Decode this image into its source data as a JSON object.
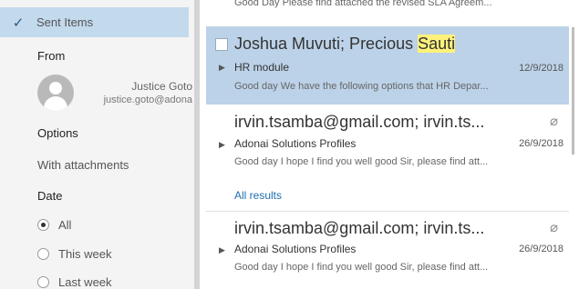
{
  "filters": {
    "folder_selected": "Sent Items",
    "from_heading": "From",
    "person": {
      "name": "Justice Goto",
      "email": "justice.goto@adona"
    },
    "options_heading": "Options",
    "with_attachments": "With attachments",
    "date_heading": "Date",
    "date_options": [
      "All",
      "This week",
      "Last week"
    ],
    "date_selected": "All"
  },
  "messages": {
    "top_preview": "Good Day  Please find attached the revised SLA Agreem...",
    "items": [
      {
        "from_plain": "Joshua Muvuti; Precious ",
        "from_highlight": "Sauti",
        "subject": "HR module",
        "date": "12/9/2018",
        "preview": "Good day  We have the following options that HR Depar...",
        "attachment": false
      },
      {
        "from_plain": "irvin.tsamba@gmail.com; irvin.ts...",
        "subject": "Adonai Solutions Profiles",
        "date": "26/9/2018",
        "preview": "Good day  I hope I find you well good Sir, please find att...",
        "attachment": true
      },
      {
        "from_plain": "irvin.tsamba@gmail.com; irvin.ts...",
        "subject": "Adonai Solutions Profiles",
        "date": "26/9/2018",
        "preview": "Good day  I hope I find you well good Sir, please find att...",
        "attachment": true
      }
    ],
    "all_results_label": "All results"
  },
  "icons": {
    "check": "checkmark-icon",
    "attachment": "paperclip-icon",
    "expand": "caret-right-icon"
  }
}
